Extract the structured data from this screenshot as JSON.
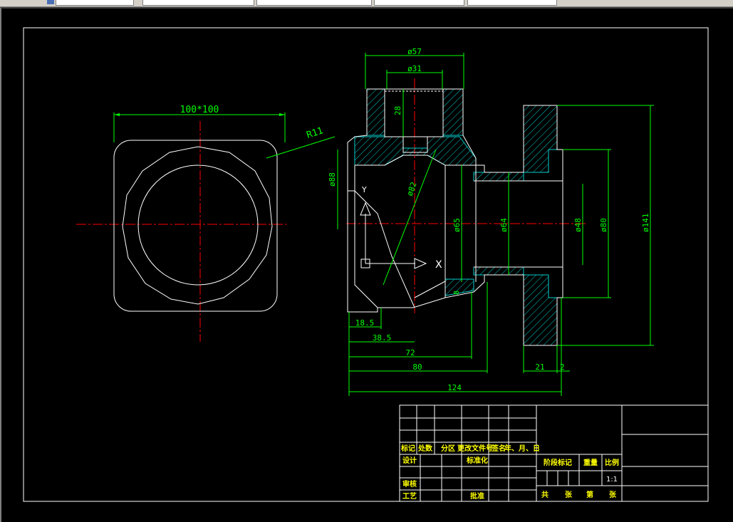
{
  "toolbar": {
    "fields": [
      "",
      "",
      "",
      "",
      ""
    ]
  },
  "colors": {
    "background": "#000000",
    "outline": "#ffffff",
    "dimension": "#00ff00",
    "centerline": "#ff0000",
    "section": "#00cccc",
    "titleblock_text": "#ffff00"
  },
  "front_view": {
    "size_label": "100*100",
    "radius_label": "R11"
  },
  "section_view": {
    "dims": {
      "d57": "ø57",
      "d31": "ø31",
      "h28": "28",
      "d88": "ø88",
      "d82": "ø82",
      "d65": "ø65",
      "d64": "ø64",
      "d48": "ø48",
      "d80": "ø80",
      "d141": "ø141",
      "l18_5": "18.5",
      "l38_5": "38.5",
      "l72": "72",
      "l80": "80",
      "l124": "124",
      "l21": "21",
      "l2": "2",
      "axis_x": "X",
      "axis_y": "Y"
    }
  },
  "title_block": {
    "row_headers": [
      "标记",
      "处数",
      "分区",
      "更改文件号",
      "签名",
      "年、月、日"
    ],
    "design": "设计",
    "standardization": "标准化",
    "review": "审核",
    "process": "工艺",
    "approve": "批准",
    "stage_mark": "阶段标记",
    "weight": "重量",
    "scale": "比例",
    "scale_value": "1:1",
    "total": "共",
    "sheet": "张",
    "page": "第",
    "sheet2": "张"
  }
}
